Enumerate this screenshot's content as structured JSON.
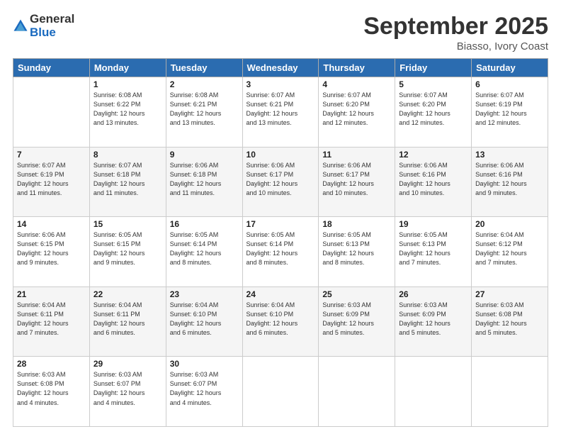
{
  "logo": {
    "general": "General",
    "blue": "Blue"
  },
  "header": {
    "month": "September 2025",
    "location": "Biasso, Ivory Coast"
  },
  "weekdays": [
    "Sunday",
    "Monday",
    "Tuesday",
    "Wednesday",
    "Thursday",
    "Friday",
    "Saturday"
  ],
  "weeks": [
    [
      {
        "day": "",
        "info": ""
      },
      {
        "day": "1",
        "info": "Sunrise: 6:08 AM\nSunset: 6:22 PM\nDaylight: 12 hours\nand 13 minutes."
      },
      {
        "day": "2",
        "info": "Sunrise: 6:08 AM\nSunset: 6:21 PM\nDaylight: 12 hours\nand 13 minutes."
      },
      {
        "day": "3",
        "info": "Sunrise: 6:07 AM\nSunset: 6:21 PM\nDaylight: 12 hours\nand 13 minutes."
      },
      {
        "day": "4",
        "info": "Sunrise: 6:07 AM\nSunset: 6:20 PM\nDaylight: 12 hours\nand 12 minutes."
      },
      {
        "day": "5",
        "info": "Sunrise: 6:07 AM\nSunset: 6:20 PM\nDaylight: 12 hours\nand 12 minutes."
      },
      {
        "day": "6",
        "info": "Sunrise: 6:07 AM\nSunset: 6:19 PM\nDaylight: 12 hours\nand 12 minutes."
      }
    ],
    [
      {
        "day": "7",
        "info": "Sunrise: 6:07 AM\nSunset: 6:19 PM\nDaylight: 12 hours\nand 11 minutes."
      },
      {
        "day": "8",
        "info": "Sunrise: 6:07 AM\nSunset: 6:18 PM\nDaylight: 12 hours\nand 11 minutes."
      },
      {
        "day": "9",
        "info": "Sunrise: 6:06 AM\nSunset: 6:18 PM\nDaylight: 12 hours\nand 11 minutes."
      },
      {
        "day": "10",
        "info": "Sunrise: 6:06 AM\nSunset: 6:17 PM\nDaylight: 12 hours\nand 10 minutes."
      },
      {
        "day": "11",
        "info": "Sunrise: 6:06 AM\nSunset: 6:17 PM\nDaylight: 12 hours\nand 10 minutes."
      },
      {
        "day": "12",
        "info": "Sunrise: 6:06 AM\nSunset: 6:16 PM\nDaylight: 12 hours\nand 10 minutes."
      },
      {
        "day": "13",
        "info": "Sunrise: 6:06 AM\nSunset: 6:16 PM\nDaylight: 12 hours\nand 9 minutes."
      }
    ],
    [
      {
        "day": "14",
        "info": "Sunrise: 6:06 AM\nSunset: 6:15 PM\nDaylight: 12 hours\nand 9 minutes."
      },
      {
        "day": "15",
        "info": "Sunrise: 6:05 AM\nSunset: 6:15 PM\nDaylight: 12 hours\nand 9 minutes."
      },
      {
        "day": "16",
        "info": "Sunrise: 6:05 AM\nSunset: 6:14 PM\nDaylight: 12 hours\nand 8 minutes."
      },
      {
        "day": "17",
        "info": "Sunrise: 6:05 AM\nSunset: 6:14 PM\nDaylight: 12 hours\nand 8 minutes."
      },
      {
        "day": "18",
        "info": "Sunrise: 6:05 AM\nSunset: 6:13 PM\nDaylight: 12 hours\nand 8 minutes."
      },
      {
        "day": "19",
        "info": "Sunrise: 6:05 AM\nSunset: 6:13 PM\nDaylight: 12 hours\nand 7 minutes."
      },
      {
        "day": "20",
        "info": "Sunrise: 6:04 AM\nSunset: 6:12 PM\nDaylight: 12 hours\nand 7 minutes."
      }
    ],
    [
      {
        "day": "21",
        "info": "Sunrise: 6:04 AM\nSunset: 6:11 PM\nDaylight: 12 hours\nand 7 minutes."
      },
      {
        "day": "22",
        "info": "Sunrise: 6:04 AM\nSunset: 6:11 PM\nDaylight: 12 hours\nand 6 minutes."
      },
      {
        "day": "23",
        "info": "Sunrise: 6:04 AM\nSunset: 6:10 PM\nDaylight: 12 hours\nand 6 minutes."
      },
      {
        "day": "24",
        "info": "Sunrise: 6:04 AM\nSunset: 6:10 PM\nDaylight: 12 hours\nand 6 minutes."
      },
      {
        "day": "25",
        "info": "Sunrise: 6:03 AM\nSunset: 6:09 PM\nDaylight: 12 hours\nand 5 minutes."
      },
      {
        "day": "26",
        "info": "Sunrise: 6:03 AM\nSunset: 6:09 PM\nDaylight: 12 hours\nand 5 minutes."
      },
      {
        "day": "27",
        "info": "Sunrise: 6:03 AM\nSunset: 6:08 PM\nDaylight: 12 hours\nand 5 minutes."
      }
    ],
    [
      {
        "day": "28",
        "info": "Sunrise: 6:03 AM\nSunset: 6:08 PM\nDaylight: 12 hours\nand 4 minutes."
      },
      {
        "day": "29",
        "info": "Sunrise: 6:03 AM\nSunset: 6:07 PM\nDaylight: 12 hours\nand 4 minutes."
      },
      {
        "day": "30",
        "info": "Sunrise: 6:03 AM\nSunset: 6:07 PM\nDaylight: 12 hours\nand 4 minutes."
      },
      {
        "day": "",
        "info": ""
      },
      {
        "day": "",
        "info": ""
      },
      {
        "day": "",
        "info": ""
      },
      {
        "day": "",
        "info": ""
      }
    ]
  ]
}
